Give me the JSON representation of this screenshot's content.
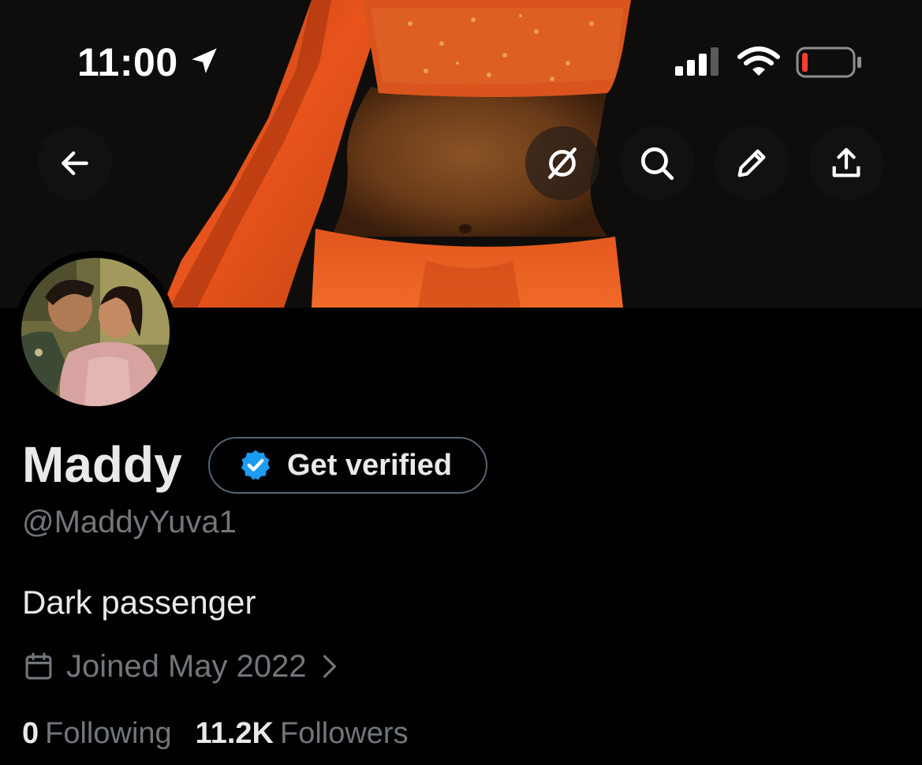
{
  "status_bar": {
    "time": "11:00",
    "icons": [
      "location-arrow-icon",
      "cellular-signal-icon",
      "wifi-icon",
      "battery-low-icon"
    ]
  },
  "toolbar": {
    "icons": [
      "back-arrow-icon",
      "grok-icon",
      "search-icon",
      "edit-pencil-icon",
      "share-icon"
    ]
  },
  "profile": {
    "display_name": "Maddy",
    "get_verified_label": "Get verified",
    "handle": "@MaddyYuva1",
    "bio": "Dark passenger",
    "joined": "Joined May 2022",
    "following_count": "0",
    "following_label": "Following",
    "followers_count": "11.2K",
    "followers_label": "Followers"
  },
  "colors": {
    "background": "#000000",
    "primary_text": "#e7e9ea",
    "secondary_text": "#71767b",
    "verified_blue": "#1d9bf0",
    "battery_red": "#ff3b30",
    "banner_orange": "#e8541c"
  }
}
